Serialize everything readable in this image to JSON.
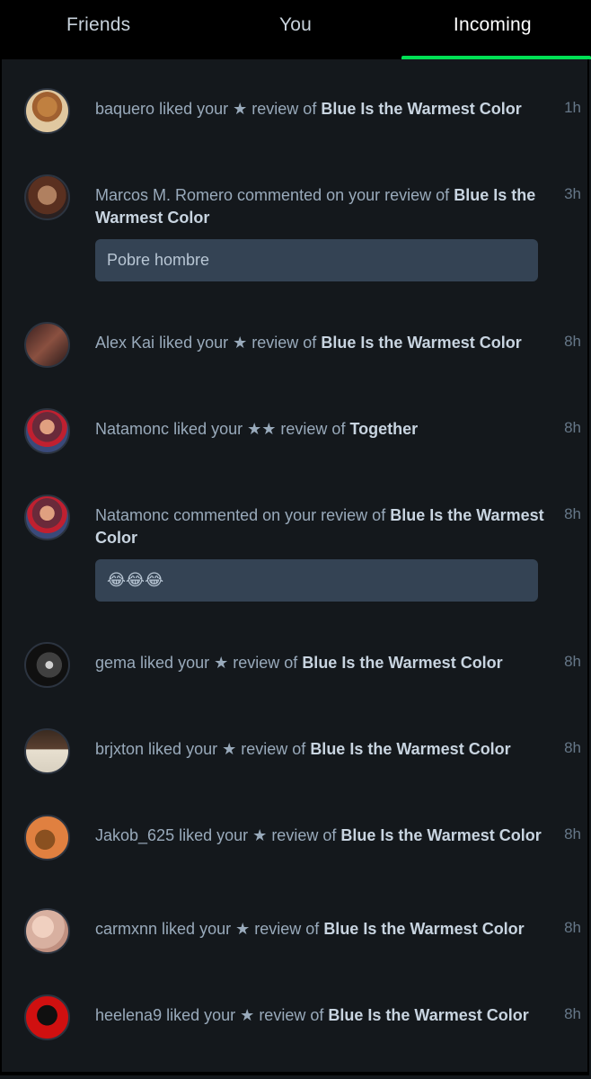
{
  "tabs": [
    {
      "label": "Friends",
      "active": false
    },
    {
      "label": "You",
      "active": false
    },
    {
      "label": "Incoming",
      "active": true
    }
  ],
  "accent_color": "#00e054",
  "notifications": [
    {
      "user": "baquero",
      "action": "liked your",
      "stars": "★",
      "mid": "review of",
      "film": "Blue Is the Warmest Color",
      "time": "1h",
      "comment": null
    },
    {
      "user": "Marcos M. Romero",
      "action": "commented on your",
      "stars": "",
      "mid": "review of",
      "film": "Blue Is the Warmest Color",
      "time": "3h",
      "comment": "Pobre hombre"
    },
    {
      "user": "Alex Kai",
      "action": "liked your",
      "stars": "★",
      "mid": "review of",
      "film": "Blue Is the Warmest Color",
      "time": "8h",
      "comment": null
    },
    {
      "user": "Natamonc",
      "action": "liked your",
      "stars": "★★",
      "mid": "review of",
      "film": "Together",
      "time": "8h",
      "comment": null
    },
    {
      "user": "Natamonc",
      "action": "commented on your",
      "stars": "",
      "mid": "review of",
      "film": "Blue Is the Warmest Color",
      "time": "8h",
      "comment": "😂😂😂"
    },
    {
      "user": "gema",
      "action": "liked your",
      "stars": "★",
      "mid": "review of",
      "film": "Blue Is the Warmest Color",
      "time": "8h",
      "comment": null
    },
    {
      "user": "brjxton",
      "action": "liked your",
      "stars": "★",
      "mid": "review of",
      "film": "Blue Is the Warmest Color",
      "time": "8h",
      "comment": null
    },
    {
      "user": "Jakob_625",
      "action": "liked your",
      "stars": "★",
      "mid": "review of",
      "film": "Blue Is the Warmest Color",
      "time": "8h",
      "comment": null
    },
    {
      "user": "carmxnn",
      "action": "liked your",
      "stars": "★",
      "mid": "review of",
      "film": "Blue Is the Warmest Color",
      "time": "8h",
      "comment": null
    },
    {
      "user": "heelena9",
      "action": "liked your",
      "stars": "★",
      "mid": "review of",
      "film": "Blue Is the Warmest Color",
      "time": "8h",
      "comment": null
    }
  ]
}
